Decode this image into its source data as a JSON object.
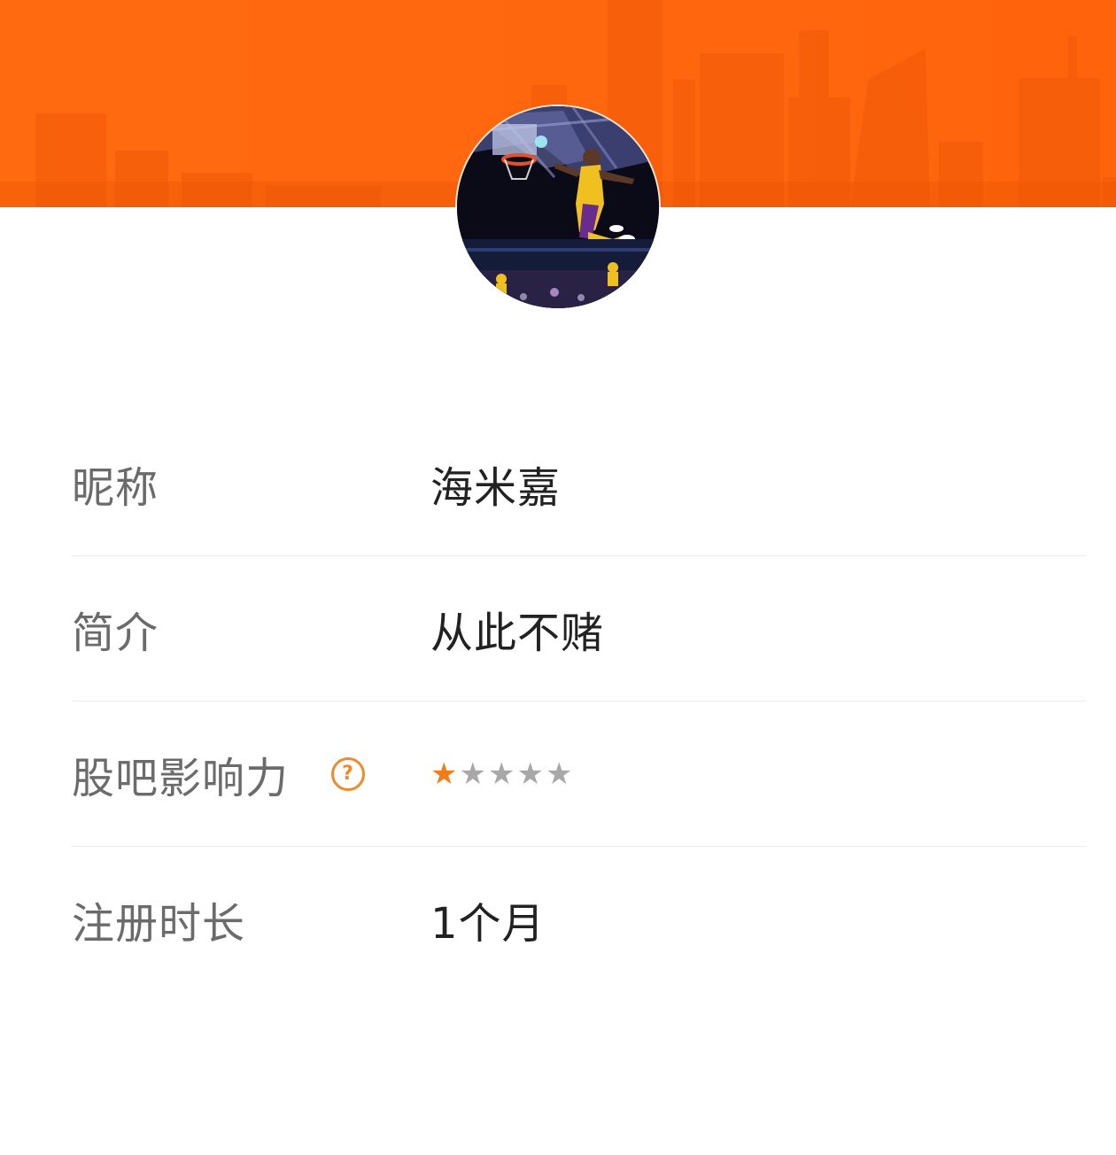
{
  "profile": {
    "colors": {
      "banner": "#ff6a10",
      "accent": "#f08a2c",
      "star_on": "#f07d1a",
      "star_off": "#a8a8a8"
    },
    "avatar_icon": "basketball-player-photo",
    "rows": [
      {
        "label": "昵称",
        "value": "海米嘉"
      },
      {
        "label": "简介",
        "value": "从此不赌"
      },
      {
        "label": "股吧影响力",
        "help_icon": "question-circle-icon",
        "rating": 1,
        "rating_max": 5
      },
      {
        "label": "注册时长",
        "value": "1个月"
      }
    ]
  }
}
